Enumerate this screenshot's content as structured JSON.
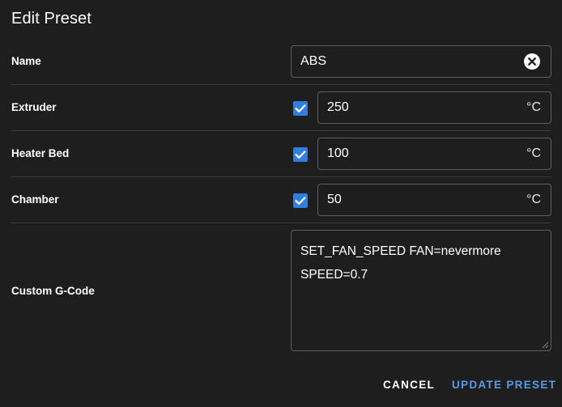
{
  "dialog": {
    "title": "Edit Preset"
  },
  "name_row": {
    "label": "Name",
    "value": "ABS"
  },
  "extruder_row": {
    "label": "Extruder",
    "value": "250",
    "unit": "°C",
    "checked": true
  },
  "bed_row": {
    "label": "Heater Bed",
    "value": "100",
    "unit": "°C",
    "checked": true
  },
  "chamber_row": {
    "label": "Chamber",
    "value": "50",
    "unit": "°C",
    "checked": true
  },
  "gcode_row": {
    "label": "Custom G-Code",
    "value": "SET_FAN_SPEED FAN=nevermore\nSPEED=0.7"
  },
  "actions": {
    "cancel_label": "CANCEL",
    "update_label": "UPDATE PRESET"
  },
  "colors": {
    "background": "#1e1e1e",
    "accent": "#2f7ee0",
    "primary_text": "#5b9bea"
  },
  "icons": {
    "clear": "close-circle-icon",
    "checkbox": "check-icon",
    "resize": "resize-handle-icon"
  }
}
